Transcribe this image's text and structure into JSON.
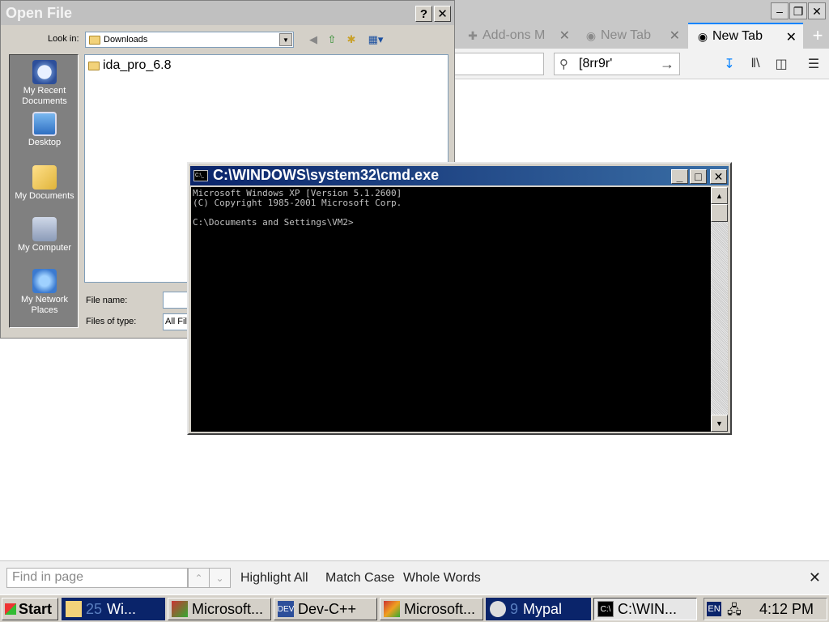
{
  "browser": {
    "tabs": [
      {
        "label": "Add-ons M",
        "icon": "puzzle-icon",
        "active": false
      },
      {
        "label": "New Tab",
        "icon": "eye-icon",
        "active": false
      },
      {
        "label": "New Tab",
        "icon": "eye-icon",
        "active": true
      }
    ],
    "search_value": "[8rr9r'"
  },
  "open_dialog": {
    "title": "Open File",
    "look_in_label": "Look in:",
    "look_in_value": "Downloads",
    "places": [
      "My Recent\nDocuments",
      "Desktop",
      "My Documents",
      "My Computer",
      "My Network\nPlaces"
    ],
    "files": [
      "ida_pro_6.8"
    ],
    "file_name_label": "File name:",
    "file_name_value": "",
    "files_of_type_label": "Files of type:",
    "files_of_type_value": "All Files"
  },
  "cmd": {
    "title": "C:\\WINDOWS\\system32\\cmd.exe",
    "lines": [
      "Microsoft Windows XP [Version 5.1.2600]",
      "(C) Copyright 1985-2001 Microsoft Corp.",
      "",
      "C:\\Documents and Settings\\VM2>"
    ]
  },
  "findbar": {
    "placeholder": "Find in page",
    "highlight_all": "Highlight All",
    "match_case": "Match Case",
    "whole_words": "Whole Words"
  },
  "taskbar": {
    "start_label": "Start",
    "tasks": [
      {
        "count": "25",
        "label": "Wi...",
        "style": "blue"
      },
      {
        "count": "",
        "label": "Microsoft...",
        "style": "normal"
      },
      {
        "count": "",
        "label": "Dev-C++",
        "style": "normal"
      },
      {
        "count": "",
        "label": "Microsoft...",
        "style": "normal"
      },
      {
        "count": "9",
        "label": "Mypal",
        "style": "blue"
      },
      {
        "count": "",
        "label": "C:\\WIN...",
        "style": "pressed"
      }
    ],
    "language": "EN",
    "clock": "4:12 PM"
  }
}
